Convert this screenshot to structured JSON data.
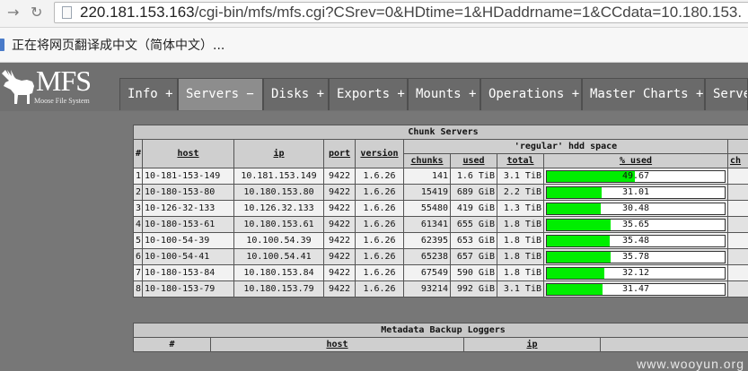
{
  "browser": {
    "url_host": "220.181.153.163",
    "url_path": "/cgi-bin/mfs/mfs.cgi?CSrev=0&HDtime=1&HDaddrname=1&CCdata=10.180.153.",
    "translate_message": "正在将网页翻译成中文（简体中文）..."
  },
  "logo": {
    "text": "MFS",
    "subtitle": "Moose File System"
  },
  "tabs": [
    {
      "label": "Info +"
    },
    {
      "label": "Servers −"
    },
    {
      "label": "Disks +"
    },
    {
      "label": "Exports +"
    },
    {
      "label": "Mounts +"
    },
    {
      "label": "Operations +"
    },
    {
      "label": "Master Charts +"
    },
    {
      "label": "Serve"
    }
  ],
  "chunk_servers": {
    "title": "Chunk Servers",
    "space_group": "'regular' hdd space",
    "headers": {
      "num": "#",
      "host": "host",
      "ip": "ip",
      "port": "port",
      "version": "version",
      "chunks": "chunks",
      "used": "used",
      "total": "total",
      "pct_used": "% used",
      "next": "ch"
    },
    "rows": [
      {
        "num": "1",
        "host": "10-181-153-149",
        "ip": "10.181.153.149",
        "port": "9422",
        "version": "1.6.26",
        "chunks": "141",
        "used": "1.6 TiB",
        "total": "3.1 TiB",
        "pct_text": "49.67",
        "pct": 49.67
      },
      {
        "num": "2",
        "host": "10-180-153-80",
        "ip": "10.180.153.80",
        "port": "9422",
        "version": "1.6.26",
        "chunks": "15419",
        "used": "689 GiB",
        "total": "2.2 TiB",
        "pct_text": "31.01",
        "pct": 31.01
      },
      {
        "num": "3",
        "host": "10-126-32-133",
        "ip": "10.126.32.133",
        "port": "9422",
        "version": "1.6.26",
        "chunks": "55480",
        "used": "419 GiB",
        "total": "1.3 TiB",
        "pct_text": "30.48",
        "pct": 30.48
      },
      {
        "num": "4",
        "host": "10-180-153-61",
        "ip": "10.180.153.61",
        "port": "9422",
        "version": "1.6.26",
        "chunks": "61341",
        "used": "655 GiB",
        "total": "1.8 TiB",
        "pct_text": "35.65",
        "pct": 35.65
      },
      {
        "num": "5",
        "host": "10-100-54-39",
        "ip": "10.100.54.39",
        "port": "9422",
        "version": "1.6.26",
        "chunks": "62395",
        "used": "653 GiB",
        "total": "1.8 TiB",
        "pct_text": "35.48",
        "pct": 35.48
      },
      {
        "num": "6",
        "host": "10-100-54-41",
        "ip": "10.100.54.41",
        "port": "9422",
        "version": "1.6.26",
        "chunks": "65238",
        "used": "657 GiB",
        "total": "1.8 TiB",
        "pct_text": "35.78",
        "pct": 35.78
      },
      {
        "num": "7",
        "host": "10-180-153-84",
        "ip": "10.180.153.84",
        "port": "9422",
        "version": "1.6.26",
        "chunks": "67549",
        "used": "590 GiB",
        "total": "1.8 TiB",
        "pct_text": "32.12",
        "pct": 32.12
      },
      {
        "num": "8",
        "host": "10-180-153-79",
        "ip": "10.180.153.79",
        "port": "9422",
        "version": "1.6.26",
        "chunks": "93214",
        "used": "992 GiB",
        "total": "3.1 TiB",
        "pct_text": "31.47",
        "pct": 31.47
      }
    ]
  },
  "metadata_loggers": {
    "title": "Metadata Backup Loggers",
    "headers": {
      "num": "#",
      "host": "host",
      "ip": "ip"
    }
  },
  "watermark": "www.wooyun.org",
  "colors": {
    "bar_fill": "#00ee00",
    "header_bg": "#707070"
  }
}
